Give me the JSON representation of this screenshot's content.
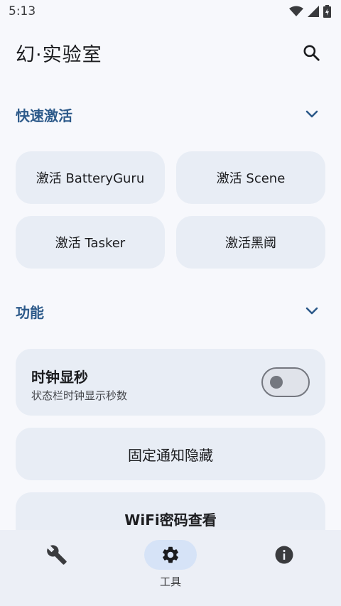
{
  "status_bar": {
    "time": "5:13"
  },
  "app_bar": {
    "title": "幻·实验室"
  },
  "sections": {
    "quick_activate": {
      "title": "快速激活"
    },
    "features": {
      "title": "功能"
    }
  },
  "activate_buttons": [
    {
      "label": "激活 BatteryGuru"
    },
    {
      "label": "激活 Scene"
    },
    {
      "label": "激活 Tasker"
    },
    {
      "label": "激活黑阈"
    }
  ],
  "clock_seconds": {
    "title": "时钟显秒",
    "subtitle": "状态栏时钟显示秒数",
    "enabled": false
  },
  "actions": [
    {
      "label": "固定通知隐藏"
    },
    {
      "label": "WiFi密码查看"
    }
  ],
  "bottom_nav": {
    "tools_label": "工具"
  },
  "colors": {
    "accent": "#2d5a8a",
    "card": "#e8edf5",
    "nav_active": "#d6e3f7"
  }
}
